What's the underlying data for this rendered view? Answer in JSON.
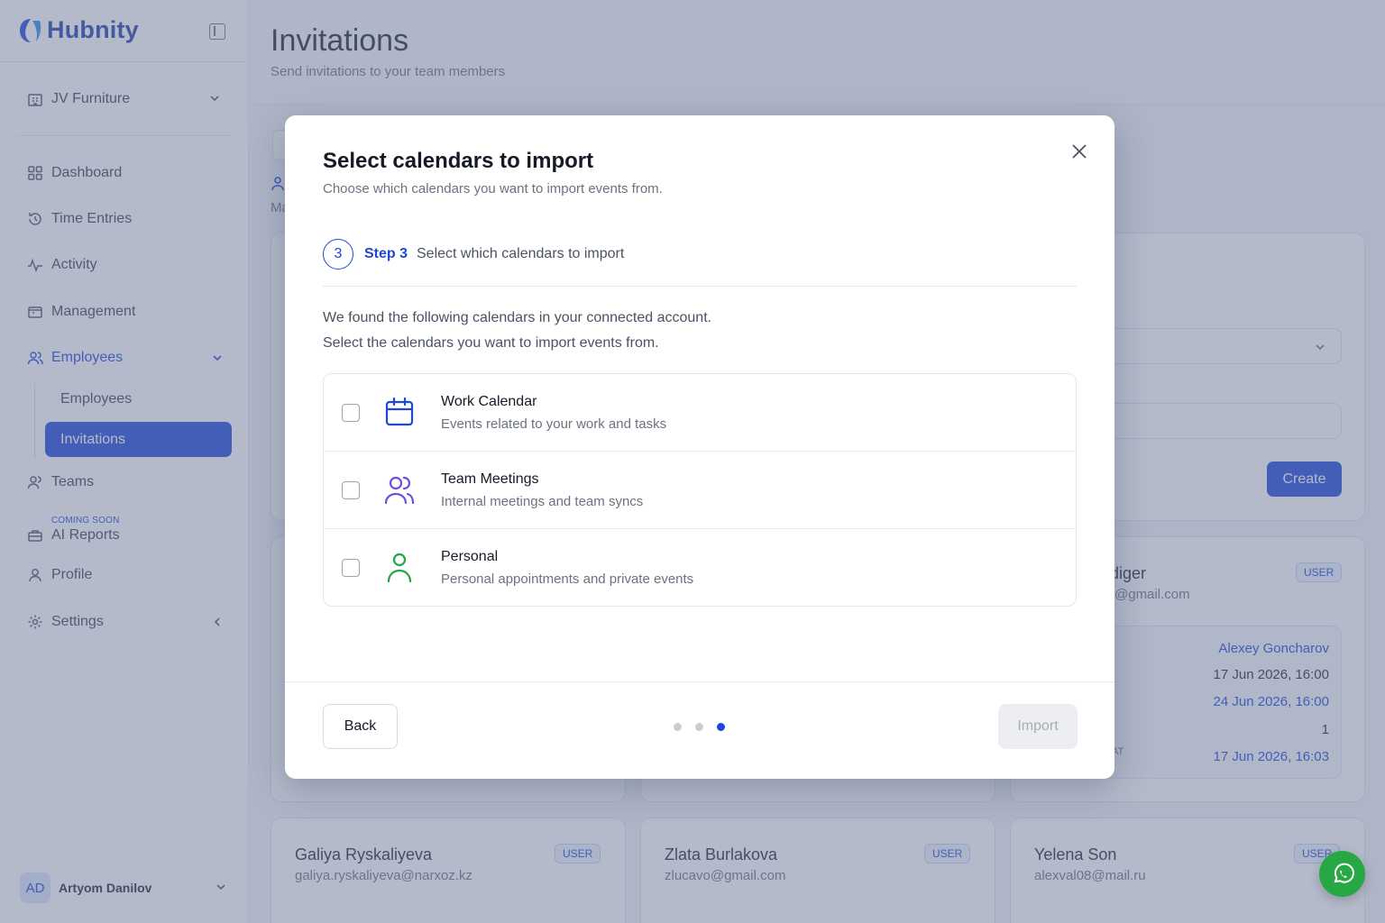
{
  "brand": {
    "name": "Hubnity",
    "color": "#1d47d8"
  },
  "sidebar": {
    "company": "JV Furniture",
    "items": [
      {
        "label": "Dashboard",
        "icon": "dashboard-icon"
      },
      {
        "label": "Time Entries",
        "icon": "history-icon"
      },
      {
        "label": "Activity",
        "icon": "activity-icon"
      },
      {
        "label": "Management",
        "icon": "folder-icon"
      },
      {
        "label": "Employees",
        "icon": "users-icon"
      },
      {
        "label": "Teams",
        "icon": "team-icon"
      },
      {
        "label": "AI Reports",
        "icon": "briefcase-icon",
        "badge": "COMING SOON"
      },
      {
        "label": "Profile",
        "icon": "user-icon"
      },
      {
        "label": "Settings",
        "icon": "gear-icon"
      }
    ],
    "sub_items": [
      "Employees",
      "Invitations"
    ],
    "user": {
      "initials": "AD",
      "name": "Artyom Danilov"
    }
  },
  "page": {
    "title": "Invitations",
    "subtitle": "Send invitations to your team members",
    "bg_tab_text": "Ma",
    "create_label": "Create"
  },
  "cards": [
    {
      "name": "diger",
      "email": "r@gmail.com",
      "role": "USER",
      "info": [
        "Alexey Goncharov",
        "17 Jun 2026, 16:00",
        "24 Jun 2026, 16:00",
        "1",
        "17 Jun 2026, 16:03"
      ],
      "info_label": "AT"
    },
    {
      "name": "Galiya Ryskaliyeva",
      "email": "galiya.ryskaliyeva@narxoz.kz",
      "role": "USER"
    },
    {
      "name": "Zlata Burlakova",
      "email": "zlucavo@gmail.com",
      "role": "USER"
    },
    {
      "name": "Yelena Son",
      "email": "alexval08@mail.ru",
      "role": "USER"
    }
  ],
  "modal": {
    "title": "Select calendars to import",
    "subtitle": "Choose which calendars you want to import events from.",
    "step_number": "3",
    "step_label": "Step 3",
    "step_desc": "Select which calendars to import",
    "intro_line1": "We found the following calendars in your connected account.",
    "intro_line2": "Select the calendars you want to import events from.",
    "calendars": [
      {
        "name": "Work Calendar",
        "desc": "Events related to your work and tasks",
        "icon": "calendar-icon",
        "color": "#1d47d8",
        "checked": false
      },
      {
        "name": "Team Meetings",
        "desc": "Internal meetings and team syncs",
        "icon": "team-icon",
        "color": "#6d4ee0",
        "checked": false
      },
      {
        "name": "Personal",
        "desc": "Personal appointments and private events",
        "icon": "person-icon",
        "color": "#1fa74a",
        "checked": false
      }
    ],
    "back_label": "Back",
    "import_label": "Import",
    "steps_total": 3,
    "current_step": 3
  }
}
